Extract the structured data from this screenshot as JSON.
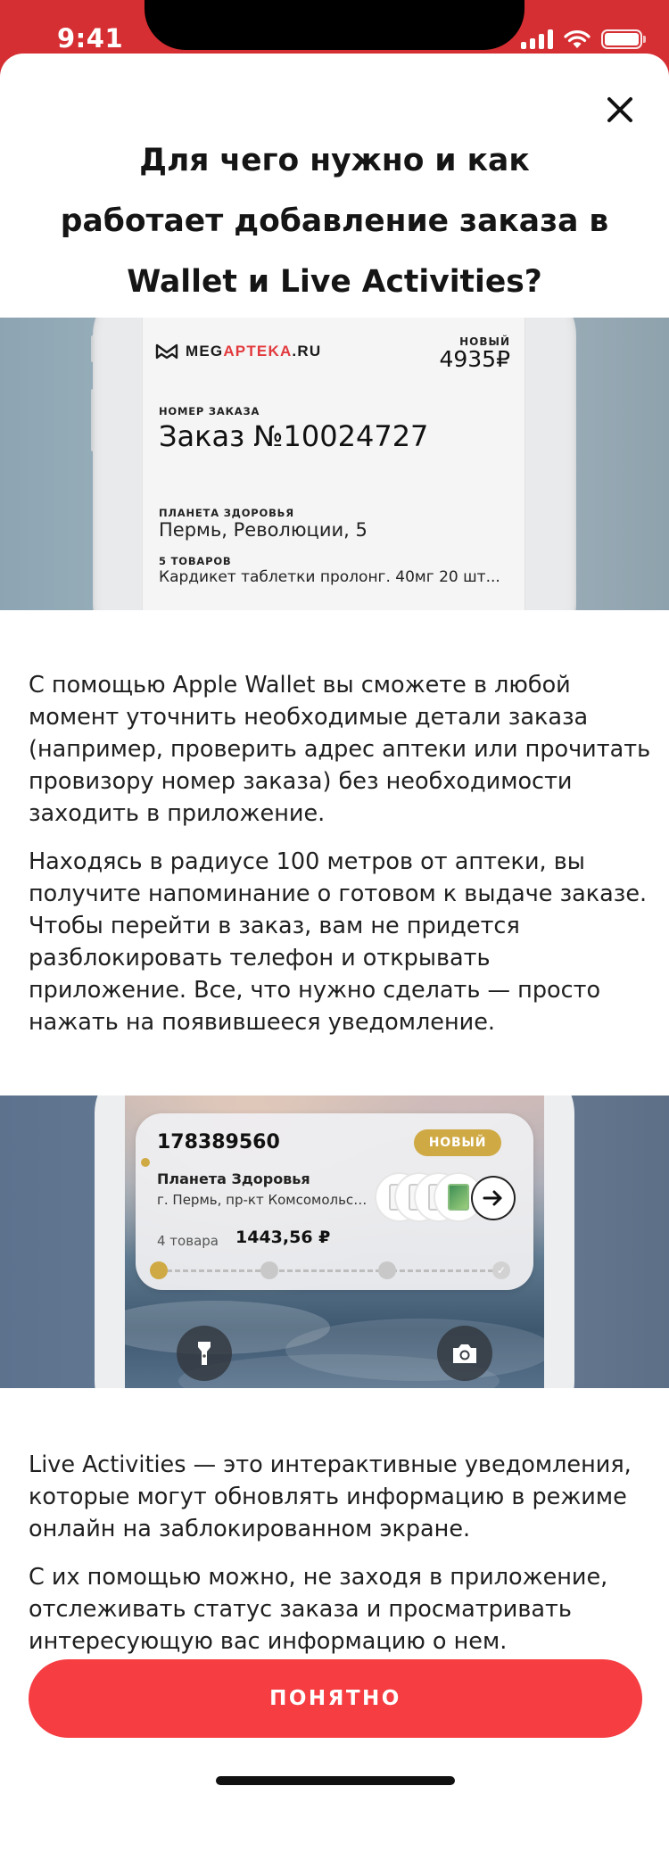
{
  "status_bar": {
    "time": "9:41",
    "icons": [
      "signal-icon",
      "wifi-icon",
      "battery-icon"
    ]
  },
  "sheet": {
    "title": "Для чего нужно и как работает добавление заказа в Wallet и Live Activities?",
    "close_icon": "close-icon"
  },
  "wallet_pass": {
    "logo_prefix": "MEG",
    "logo_accent": "APTEKA",
    "logo_suffix": ".RU",
    "status_label": "НОВЫЙ",
    "price": "4935₽",
    "order_label": "НОМЕР ЗАКАЗА",
    "order_title": "Заказ №10024727",
    "store_label": "ПЛАНЕТА ЗДОРОВЬЯ",
    "store_address": "Пермь, Революции, 5",
    "items_label": "5 ТОВАРОВ",
    "items_preview": "Кардикет таблетки пролонг. 40мг 20 шт..."
  },
  "wallet_text": [
    "С помощью Apple Wallet вы сможете в любой момент уточнить необходимые детали заказа (например, проверить адрес аптеки или прочитать провизору номер заказа) без необходимости заходить в приложение.",
    "Находясь в радиусе 100 метров от аптеки, вы получите напоминание о готовом к выдаче заказе. Чтобы перейти в заказ, вам не придется разблокировать телефон и открывать приложение. Все, что нужно сделать — просто нажать на появившееся уведомление."
  ],
  "live_activity": {
    "order_number": "178389560",
    "badge": "НОВЫЙ",
    "store": "Планета Здоровья",
    "address": "г. Пермь, пр-кт Комсомольский",
    "items_count": "4 товара",
    "total": "1443,56 ₽",
    "progress_steps": 4,
    "progress_current": 1,
    "lock_buttons": [
      "flashlight-icon",
      "camera-icon"
    ]
  },
  "live_text": [
    "Live Activities — это интерактивные уведомления, которые могут обновлять информацию в режиме онлайн на заблокированном экране.",
    "С их помощью можно, не заходя в приложение, отслеживать статус заказа и просматривать интересующую вас информацию о нем."
  ],
  "cta": {
    "label": "ПОНЯТНО"
  },
  "colors": {
    "brand_red": "#f53d42",
    "status_bar_red": "#d62f33",
    "badge_gold": "#cfa944"
  }
}
